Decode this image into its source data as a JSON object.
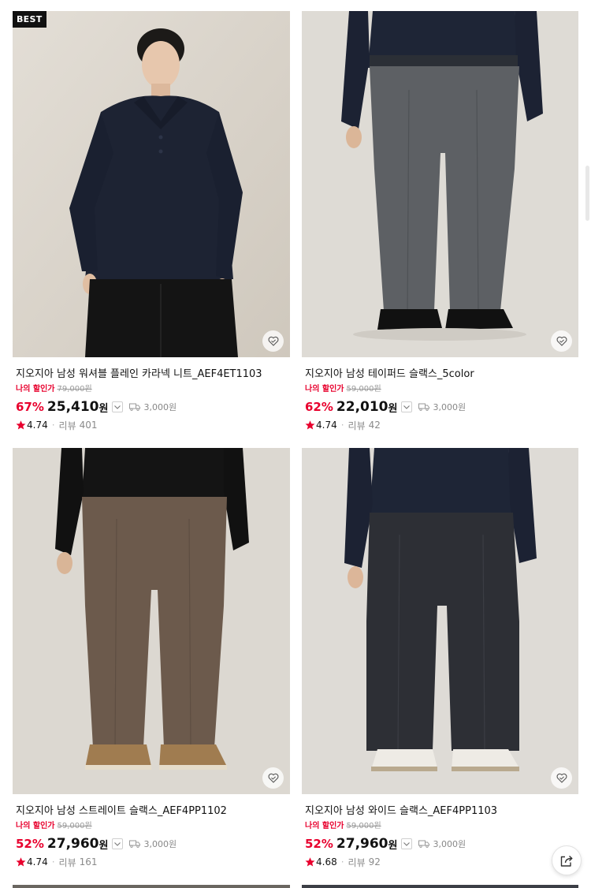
{
  "products": [
    {
      "badge": "BEST",
      "name": "지오지아 남성 워셔블 플레인 카라넥 니트_AEF4ET1103",
      "discount_label": "나의 할인가",
      "original_price": "79,000원",
      "discount_percent": "67%",
      "price": "25,410",
      "currency": "원",
      "shipping": "3,000원",
      "rating": "4.74",
      "review_label": "리뷰",
      "review_count": "401",
      "photo": "navy-polo-knit"
    },
    {
      "badge": "",
      "name": "지오지아 남성 테이퍼드 슬랙스_5color",
      "discount_label": "나의 할인가",
      "original_price": "59,000원",
      "discount_percent": "62%",
      "price": "22,010",
      "currency": "원",
      "shipping": "3,000원",
      "rating": "4.74",
      "review_label": "리뷰",
      "review_count": "42",
      "photo": "grey-tapered-slacks"
    },
    {
      "badge": "",
      "name": "지오지아 남성 스트레이트 슬랙스_AEF4PP1102",
      "discount_label": "나의 할인가",
      "original_price": "59,000원",
      "discount_percent": "52%",
      "price": "27,960",
      "currency": "원",
      "shipping": "3,000원",
      "rating": "4.74",
      "review_label": "리뷰",
      "review_count": "161",
      "photo": "brown-straight-slacks"
    },
    {
      "badge": "",
      "name": "지오지아 남성 와이드 슬랙스_AEF4PP1103",
      "discount_label": "나의 할인가",
      "original_price": "59,000원",
      "discount_percent": "52%",
      "price": "27,960",
      "currency": "원",
      "shipping": "3,000원",
      "rating": "4.68",
      "review_label": "리뷰",
      "review_count": "92",
      "photo": "charcoal-wide-slacks"
    }
  ],
  "icons": {
    "wishlist": "heart-icon",
    "expand": "chevron-down-icon",
    "shipping": "truck-icon",
    "rating": "star-icon",
    "share": "share-icon"
  },
  "colors": {
    "accent": "#e8002d",
    "text": "#111111",
    "muted": "#888888",
    "badge_bg": "#111111"
  }
}
